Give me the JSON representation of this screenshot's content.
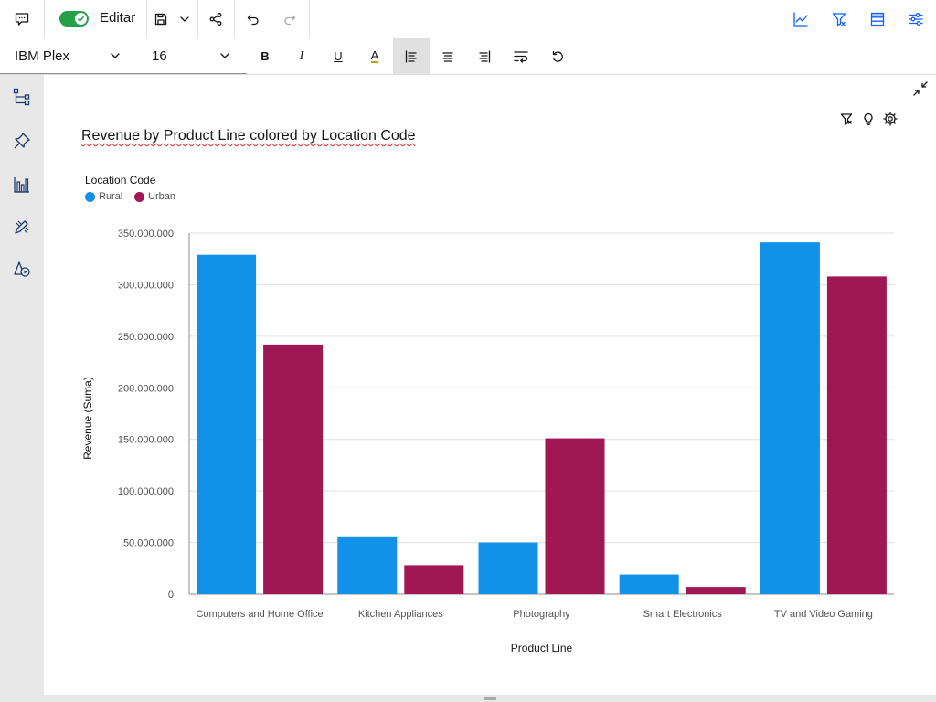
{
  "toolbar": {
    "edit_label": "Editar",
    "font_family": "IBM Plex",
    "font_size": "16",
    "bold": "B",
    "italic": "I",
    "underline": "U",
    "font_color": "A"
  },
  "chart_data": {
    "type": "bar",
    "title": "Revenue by Product Line colored by Location Code",
    "legend_title": "Location Code",
    "legend_placement": "top-left",
    "categories": [
      "Computers and Home Office",
      "Kitchen Appliances",
      "Photography",
      "Smart Electronics",
      "TV and Video Gaming"
    ],
    "series": [
      {
        "name": "Rural",
        "color": "#1192e8",
        "values": [
          329000000,
          56000000,
          50000000,
          19000000,
          341000000
        ]
      },
      {
        "name": "Urban",
        "color": "#9f1853",
        "values": [
          242000000,
          28000000,
          151000000,
          7000000,
          308000000
        ]
      }
    ],
    "xlabel": "Product Line",
    "ylabel": "Revenue (Suma)",
    "ylim": [
      0,
      350000000
    ],
    "yticks": [
      0,
      50000000,
      100000000,
      150000000,
      200000000,
      250000000,
      300000000,
      350000000
    ],
    "ytick_labels": [
      "0",
      "50.000.000",
      "100.000.000",
      "150.000.000",
      "200.000.000",
      "250.000.000",
      "300.000.000",
      "350.000.000"
    ],
    "grid": true
  }
}
